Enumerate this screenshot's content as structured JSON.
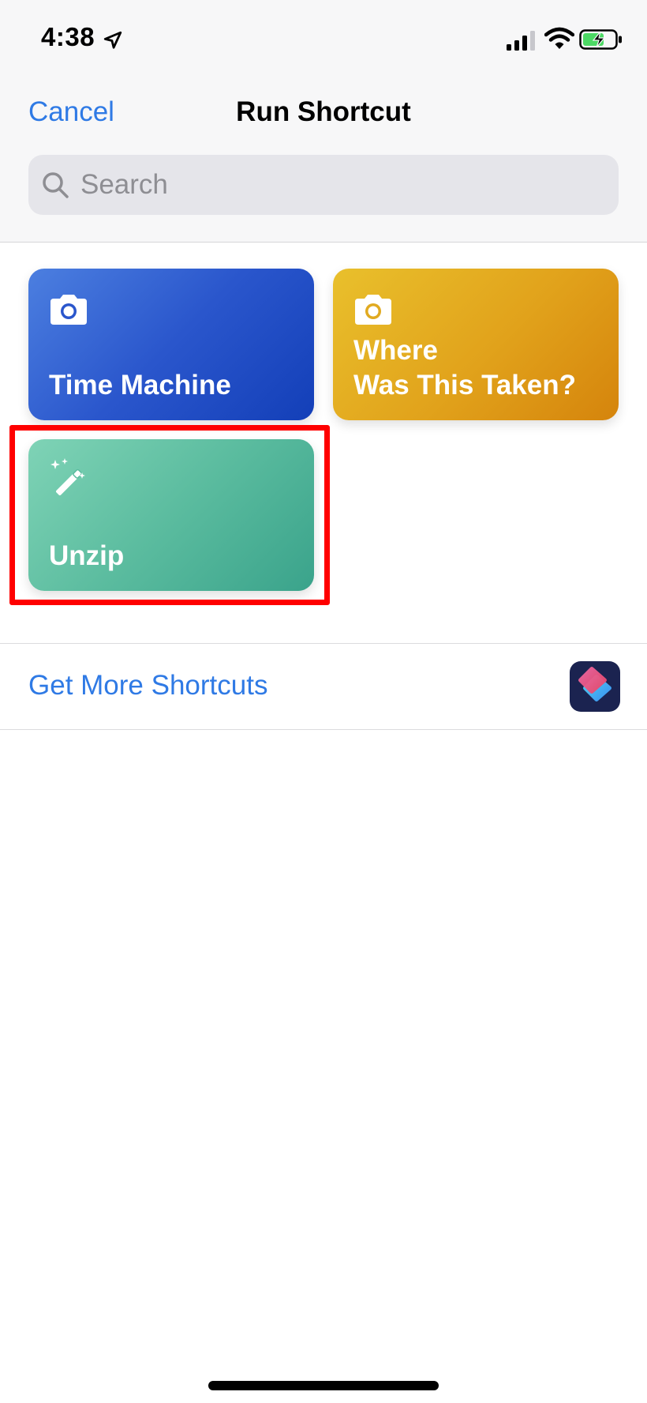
{
  "status_bar": {
    "time": "4:38"
  },
  "nav": {
    "cancel_label": "Cancel",
    "title": "Run Shortcut"
  },
  "search": {
    "placeholder": "Search",
    "value": ""
  },
  "shortcuts": [
    {
      "label_lines": [
        "Time Machine"
      ],
      "icon": "camera-icon",
      "color": "#2a56cc"
    },
    {
      "label_lines": [
        "Where",
        "Was This Taken?"
      ],
      "icon": "camera-icon",
      "color": "#e1a21b"
    },
    {
      "label_lines": [
        "Unzip"
      ],
      "icon": "magic-wand-icon",
      "color": "#5bbc9f",
      "highlighted": true
    }
  ],
  "get_more": {
    "label": "Get More Shortcuts",
    "icon": "shortcuts-app-icon"
  },
  "colors": {
    "accent": "#2f7ae5",
    "highlight": "#ff0000"
  }
}
